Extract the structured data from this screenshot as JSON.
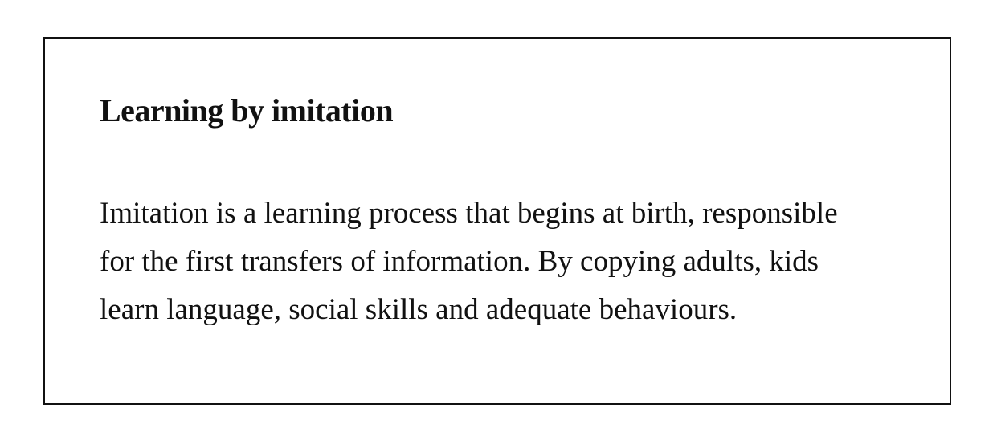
{
  "card": {
    "title": "Learning by imitation",
    "body_lines": [
      "Imitation is a learning process that begins at birth, responsible",
      "for the first transfers of information. By copying adults, kids",
      "learn language, social skills and adequate behaviours."
    ]
  }
}
